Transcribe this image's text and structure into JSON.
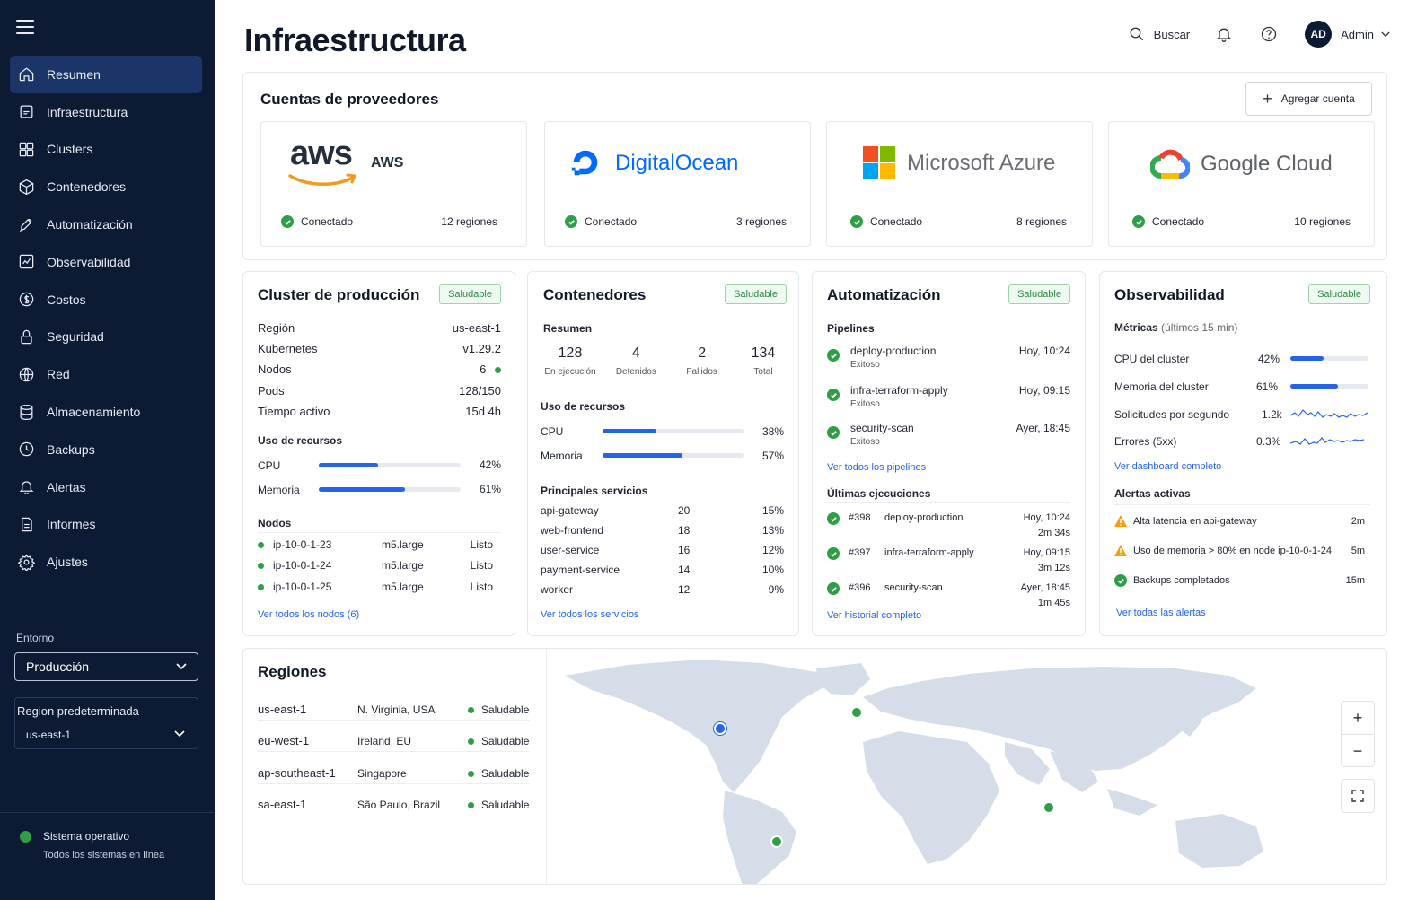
{
  "sidebar": {
    "items": [
      {
        "label": "Resumen",
        "icon": "home-icon",
        "active": true
      },
      {
        "label": "Infraestructura",
        "icon": "server-icon"
      },
      {
        "label": "Clusters",
        "icon": "cluster-icon"
      },
      {
        "label": "Contenedores",
        "icon": "cube-icon"
      },
      {
        "label": "Automatización",
        "icon": "rocket-icon"
      },
      {
        "label": "Observabilidad",
        "icon": "chart-icon"
      },
      {
        "label": "Costos",
        "icon": "dollar-icon"
      },
      {
        "label": "Seguridad",
        "icon": "lock-icon"
      },
      {
        "label": "Red",
        "icon": "globe-icon"
      },
      {
        "label": "Almacenamiento",
        "icon": "database-icon"
      },
      {
        "label": "Backups",
        "icon": "backup-icon"
      },
      {
        "label": "Alertas",
        "icon": "bell-icon"
      },
      {
        "label": "Informes",
        "icon": "document-icon"
      },
      {
        "label": "Ajustes",
        "icon": "gear-icon"
      }
    ],
    "env_label": "Entorno",
    "env_value": "Producción",
    "region_label": "Region predeterminada",
    "region_value": "us-east-1",
    "status_title": "Sistema operativo",
    "status_sub": "Todos los sistemas en línea"
  },
  "header": {
    "title": "Infraestructura",
    "search_label": "Buscar",
    "avatar": "AD",
    "user": "Admin"
  },
  "providers": {
    "title": "Cuentas de proveedores",
    "add_label": "Agregar cuenta",
    "items": [
      {
        "logo_text": "aws",
        "name": "AWS",
        "status": "Conectado",
        "regions": "12 regiones"
      },
      {
        "name": "DigitalOcean",
        "status": "Conectado",
        "regions": "3 regiones"
      },
      {
        "name": "Microsoft Azure",
        "status": "Conectado",
        "regions": "8 regiones"
      },
      {
        "name": "Google Cloud",
        "status": "Conectado",
        "regions": "10 regiones"
      }
    ]
  },
  "cluster": {
    "title": "Cluster de producción",
    "badge": "Saludable",
    "info": [
      {
        "k": "Región",
        "v": "us-east-1"
      },
      {
        "k": "Kubernetes",
        "v": "v1.29.2"
      },
      {
        "k": "Nodos",
        "v": "6"
      },
      {
        "k": "Pods",
        "v": "128/150"
      },
      {
        "k": "Tiempo activo",
        "v": "15d 4h"
      }
    ],
    "usage_title": "Uso de recursos",
    "usage": [
      {
        "label": "CPU",
        "pct": "42%",
        "value": 42
      },
      {
        "label": "Memoria",
        "pct": "61%",
        "value": 61
      }
    ],
    "nodes_title": "Nodos",
    "nodes": [
      {
        "name": "ip-10-0-1-23",
        "type": "m5.large",
        "status": "Listo"
      },
      {
        "name": "ip-10-0-1-24",
        "type": "m5.large",
        "status": "Listo"
      },
      {
        "name": "ip-10-0-1-25",
        "type": "m5.large",
        "status": "Listo"
      }
    ],
    "link": "Ver todos los nodos (6)"
  },
  "containers": {
    "title": "Contenedores",
    "badge": "Saludable",
    "summary_title": "Resumen",
    "stats": [
      {
        "value": "128",
        "label": "En ejecución"
      },
      {
        "value": "4",
        "label": "Detenidos"
      },
      {
        "value": "2",
        "label": "Fallidos"
      },
      {
        "value": "134",
        "label": "Total"
      }
    ],
    "usage_title": "Uso de recursos",
    "usage": [
      {
        "label": "CPU",
        "pct": "38%",
        "value": 38
      },
      {
        "label": "Memoria",
        "pct": "57%",
        "value": 57
      }
    ],
    "services_title": "Principales servicios",
    "services": [
      {
        "name": "api-gateway",
        "count": "20",
        "pct": "15%"
      },
      {
        "name": "web-frontend",
        "count": "18",
        "pct": "13%"
      },
      {
        "name": "user-service",
        "count": "16",
        "pct": "12%"
      },
      {
        "name": "payment-service",
        "count": "14",
        "pct": "10%"
      },
      {
        "name": "worker",
        "count": "12",
        "pct": "9%"
      }
    ],
    "link": "Ver todos los servicios"
  },
  "automation": {
    "title": "Automatización",
    "badge": "Saludable",
    "pipelines_title": "Pipelines",
    "pipelines": [
      {
        "name": "deploy-production",
        "status": "Exitoso",
        "time": "Hoy, 10:24"
      },
      {
        "name": "infra-terraform-apply",
        "status": "Exitoso",
        "time": "Hoy, 09:15"
      },
      {
        "name": "security-scan",
        "status": "Exitoso",
        "time": "Ayer, 18:45"
      }
    ],
    "pipelines_link": "Ver todos los pipelines",
    "runs_title": "Últimas ejecuciones",
    "runs": [
      {
        "id": "#398",
        "name": "deploy-production",
        "time": "Hoy, 10:24",
        "dur": "2m 34s"
      },
      {
        "id": "#397",
        "name": "infra-terraform-apply",
        "time": "Hoy, 09:15",
        "dur": "3m 12s"
      },
      {
        "id": "#396",
        "name": "security-scan",
        "time": "Ayer, 18:45",
        "dur": "1m 45s"
      }
    ],
    "runs_link": "Ver historial completo"
  },
  "observability": {
    "title": "Observabilidad",
    "badge": "Saludable",
    "metrics_title": "Métricas",
    "metrics_sub": "(últimos 15 min)",
    "metrics": [
      {
        "label": "CPU del cluster",
        "value": "42%",
        "pct": 42,
        "kind": "bar"
      },
      {
        "label": "Memoria del cluster",
        "value": "61%",
        "pct": 61,
        "kind": "bar"
      },
      {
        "label": "Solicitudes por segundo",
        "value": "1.2k",
        "kind": "spark"
      },
      {
        "label": "Errores (5xx)",
        "value": "0.3%",
        "kind": "spark"
      }
    ],
    "dash_link": "Ver dashboard completo",
    "alerts_title": "Alertas activas",
    "alerts": [
      {
        "text": "Alta latencia en api-gateway",
        "time": "2m",
        "level": "warn"
      },
      {
        "text": "Uso de memoria > 80% en node ip-10-0-1-24",
        "time": "5m",
        "level": "warn"
      },
      {
        "text": "Backups completados",
        "time": "15m",
        "level": "ok"
      }
    ],
    "alerts_link": "Ver todas las alertas"
  },
  "regions": {
    "title": "Regiones",
    "items": [
      {
        "id": "us-east-1",
        "loc": "N. Virginia, USA",
        "status": "Saludable"
      },
      {
        "id": "eu-west-1",
        "loc": "Ireland, EU",
        "status": "Saludable"
      },
      {
        "id": "ap-southeast-1",
        "loc": "Singapore",
        "status": "Saludable"
      },
      {
        "id": "sa-east-1",
        "loc": "São Paulo, Brazil",
        "status": "Saludable"
      }
    ],
    "zoom_in": "+",
    "zoom_out": "−"
  },
  "colors": {
    "accent": "#2563eb",
    "ok": "#2e9e47",
    "sidebar": "#0d1a33",
    "warn": "#f59e0b"
  }
}
